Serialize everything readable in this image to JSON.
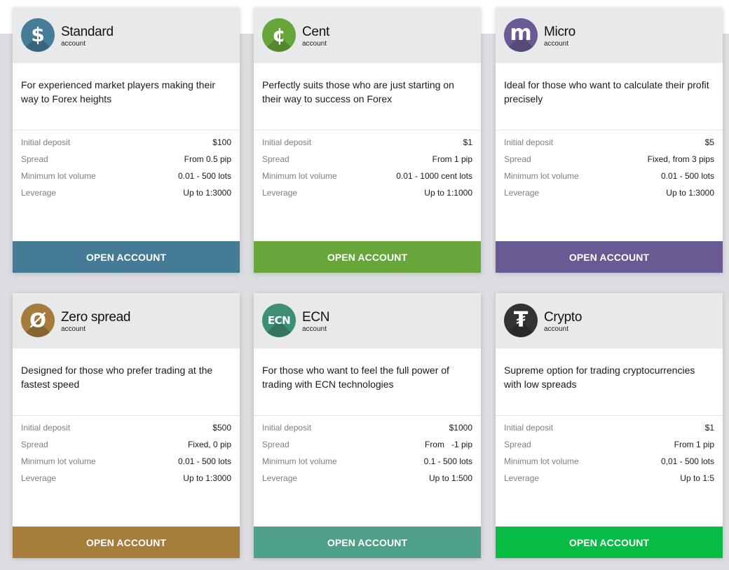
{
  "specs_labels": {
    "deposit": "Initial deposit",
    "spread": "Spread",
    "lot": "Minimum lot volume",
    "leverage": "Leverage"
  },
  "cards": [
    {
      "name": "Standard",
      "sub": "account",
      "icon": "dollar-icon",
      "glyph": "$",
      "description": "For experienced market players making their way to Forex heights",
      "deposit": "$100",
      "spread": "From 0.5 pip",
      "lot": "0.01 - 500 lots",
      "leverage": "Up to 1:3000",
      "button": "OPEN ACCOUNT",
      "color": "#457c98",
      "btn_color": "#467b97"
    },
    {
      "name": "Cent",
      "sub": "account",
      "icon": "cent-icon",
      "glyph": "¢",
      "description": "Perfectly suits those who are just starting on their way to success on Forex",
      "deposit": "$1",
      "spread": "From 1 pip",
      "lot": "0.01 - 1000 cent lots",
      "leverage": "Up to 1:1000",
      "button": "OPEN ACCOUNT",
      "color": "#67a63a",
      "btn_color": "#67a63a"
    },
    {
      "name": "Micro",
      "sub": "account",
      "icon": "micro-m-icon",
      "glyph": "m",
      "description": "Ideal for those who want to calculate their profit precisely",
      "deposit": "$5",
      "spread": "Fixed, from 3 pips",
      "lot": "0.01 - 500 lots",
      "leverage": "Up to 1:3000",
      "button": "OPEN ACCOUNT",
      "color": "#6a5a95",
      "btn_color": "#6a5a94"
    },
    {
      "name": "Zero spread",
      "sub": "account",
      "icon": "zero-slash-icon",
      "glyph": "Ø",
      "description": "Designed for those who prefer trading at the fastest speed",
      "deposit": "$500",
      "spread": "Fixed, 0 pip",
      "lot": "0.01 - 500 lots",
      "leverage": "Up to 1:3000",
      "button": "OPEN ACCOUNT",
      "color": "#a57c3c",
      "btn_color": "#a77d3c"
    },
    {
      "name": "ECN",
      "sub": "account",
      "icon": "ecn-icon",
      "glyph": "ECN",
      "description": "For those who want to feel the full power of trading with ECN technologies",
      "deposit": "$1000",
      "spread": "From   -1 pip",
      "lot": "0.1 - 500 lots",
      "leverage": "Up to 1:500",
      "button": "OPEN ACCOUNT",
      "color": "#3f8f76",
      "btn_color": "#4fa088"
    },
    {
      "name": "Crypto",
      "sub": "account",
      "icon": "tether-icon",
      "glyph": "₮",
      "description": "Supreme option for trading cryptocurrencies with low spreads",
      "deposit": "$1",
      "spread": "From 1 pip",
      "lot": "0,01 - 500 lots",
      "leverage": "Up to 1:5",
      "button": "OPEN ACCOUNT",
      "color": "#333333",
      "btn_color": "#08bb45"
    }
  ]
}
